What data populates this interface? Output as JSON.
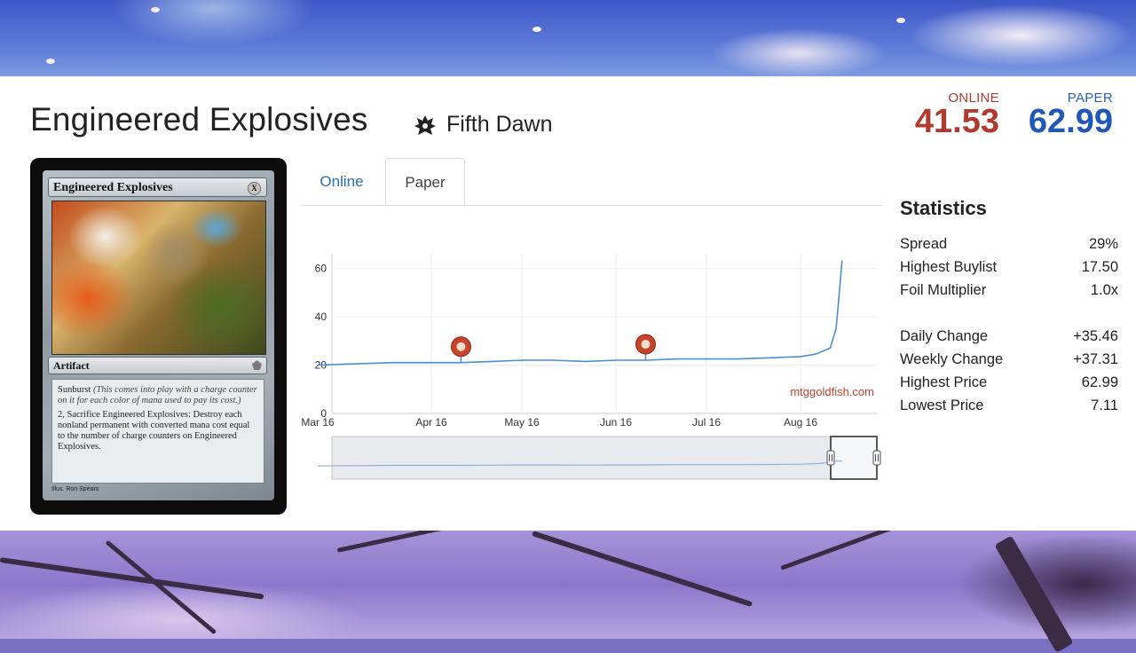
{
  "card": {
    "title": "Engineered Explosives",
    "set_name": "Fifth Dawn",
    "set_icon": "fifth-dawn-set-icon"
  },
  "prices": {
    "online_label": "ONLINE",
    "online_value": "41.53",
    "paper_label": "PAPER",
    "paper_value": "62.99",
    "online_color": "#b03a2e",
    "paper_color": "#1f58b7"
  },
  "card_image": {
    "name": "Engineered Explosives",
    "type_line": "Artifact",
    "rules_1_keyword": "Sunburst",
    "rules_1_reminder": "(This comes into play with a charge counter on it for each color of mana used to pay its cost.)",
    "rules_2": "2, Sacrifice Engineered Explosives: Destroy each nonland permanent with converted mana cost equal to the number of charge counters on Engineered Explosives.",
    "artist": "Ron Spears"
  },
  "tabs": [
    {
      "label": "Online",
      "active": false
    },
    {
      "label": "Paper",
      "active": true
    }
  ],
  "chart_data": {
    "type": "line",
    "watermark": "mtggoldfish.com",
    "x_tick_labels": [
      "Mar 16",
      "Apr 16",
      "May 16",
      "Jun 16",
      "Jul 16",
      "Aug 16"
    ],
    "y_tick_labels": [
      "0",
      "20",
      "40",
      "60"
    ],
    "ylim": [
      0,
      66
    ],
    "series": [
      {
        "color": "#4a8fd0",
        "x": [
          "Mar 16",
          "Mar 26",
          "Apr 06",
          "Apr 16",
          "Apr 26",
          "May 06",
          "May 16",
          "May 26",
          "Jun 06",
          "Jun 16",
          "Jun 26",
          "Jul 06",
          "Jul 16",
          "Jul 26",
          "Aug 06",
          "Aug 16",
          "Aug 21",
          "Aug 26",
          "Aug 28",
          "Aug 30"
        ],
        "values": [
          20,
          20.5,
          21,
          21,
          21,
          21.5,
          22,
          22,
          21.5,
          22,
          22,
          22.5,
          22.5,
          22.5,
          23,
          23.5,
          24.5,
          27,
          35,
          62.99
        ]
      }
    ],
    "event_markers": [
      {
        "x": "Apr 26",
        "icon": "set-release-icon"
      },
      {
        "x": "Jun 26",
        "icon": "set-release-icon"
      }
    ],
    "navigator": true,
    "grid": true
  },
  "statistics": {
    "title": "Statistics",
    "rows_1": [
      {
        "label": "Spread",
        "value": "29%"
      },
      {
        "label": "Highest Buylist",
        "value": "17.50"
      },
      {
        "label": "Foil Multiplier",
        "value": "1.0x"
      }
    ],
    "rows_2": [
      {
        "label": "Daily Change",
        "value": "+35.46"
      },
      {
        "label": "Weekly Change",
        "value": "+37.31"
      },
      {
        "label": "Highest Price",
        "value": "62.99"
      },
      {
        "label": "Lowest Price",
        "value": "7.11"
      }
    ]
  }
}
